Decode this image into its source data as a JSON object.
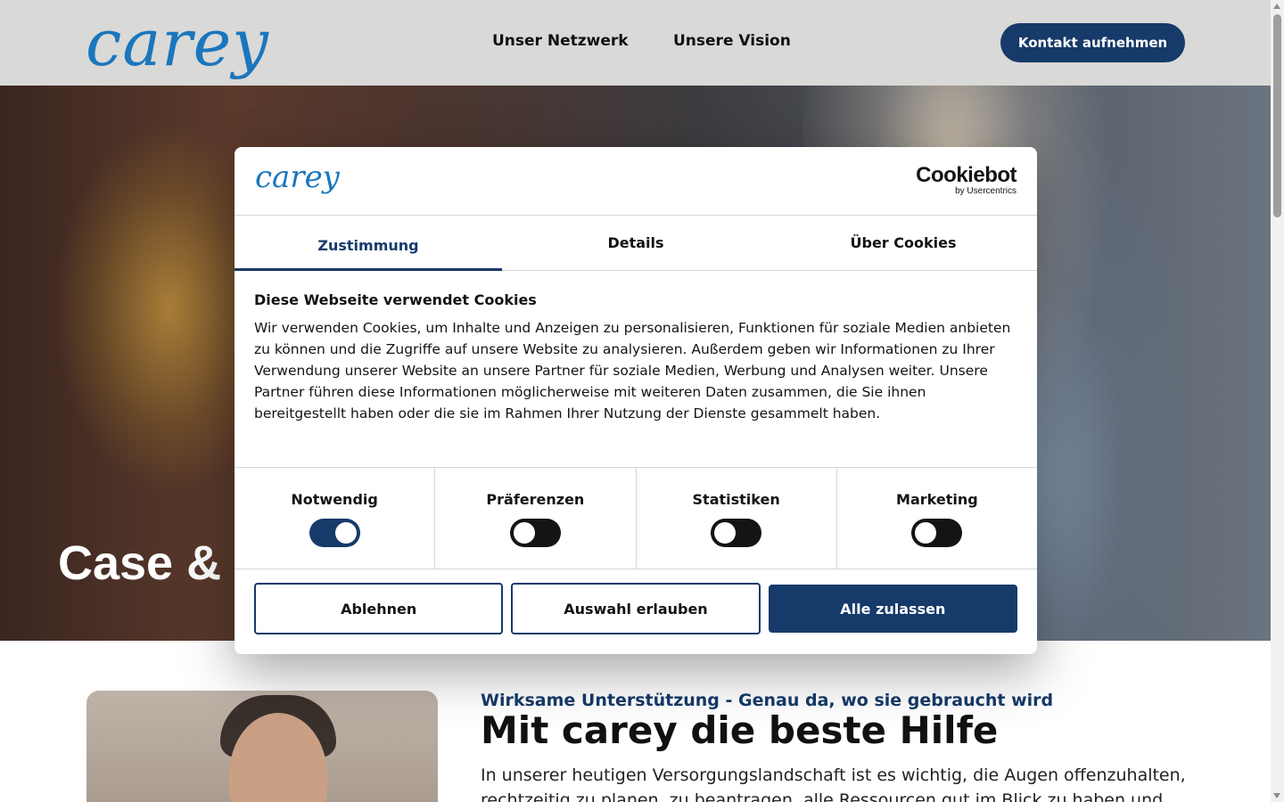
{
  "header": {
    "logo_text": "carey",
    "nav": [
      "Unser Netzwerk",
      "Unsere Vision"
    ],
    "contact_label": "Kontakt aufnehmen"
  },
  "hero": {
    "title": "Case & C"
  },
  "content": {
    "eyebrow": "Wirksame Unterstützung - Genau da, wo sie gebraucht wird",
    "title": "Mit carey die beste Hilfe",
    "text": "In unserer heutigen Versorgungslandschaft ist es wichtig, die Augen offenzuhalten, rechtzeitig zu planen, zu beantragen, alle Ressourcen gut im Blick zu haben und immer"
  },
  "dialog": {
    "logo_text": "carey",
    "cookiebot_name": "Cookiebot",
    "cookiebot_sub": "by Usercentrics",
    "tabs": [
      "Zustimmung",
      "Details",
      "Über Cookies"
    ],
    "heading": "Diese Webseite verwendet Cookies",
    "text": "Wir verwenden Cookies, um Inhalte und Anzeigen zu personalisieren, Funktionen für soziale Medien anbieten zu können und die Zugriffe auf unsere Website zu analysieren. Außerdem geben wir Informationen zu Ihrer Verwendung unserer Website an unsere Partner für soziale Medien, Werbung und Analysen weiter. Unsere Partner führen diese Informationen möglicherweise mit weiteren Daten zusammen, die Sie ihnen bereitgestellt haben oder die sie im Rahmen Ihrer Nutzung der Dienste gesammelt haben.",
    "toggles": [
      {
        "label": "Notwendig",
        "on": true
      },
      {
        "label": "Präferenzen",
        "on": false
      },
      {
        "label": "Statistiken",
        "on": false
      },
      {
        "label": "Marketing",
        "on": false
      }
    ],
    "buttons": {
      "decline": "Ablehnen",
      "allow_selection": "Auswahl erlauben",
      "allow_all": "Alle zulassen"
    }
  },
  "colors": {
    "brand_blue": "#1a76bd",
    "navy": "#163a69"
  }
}
